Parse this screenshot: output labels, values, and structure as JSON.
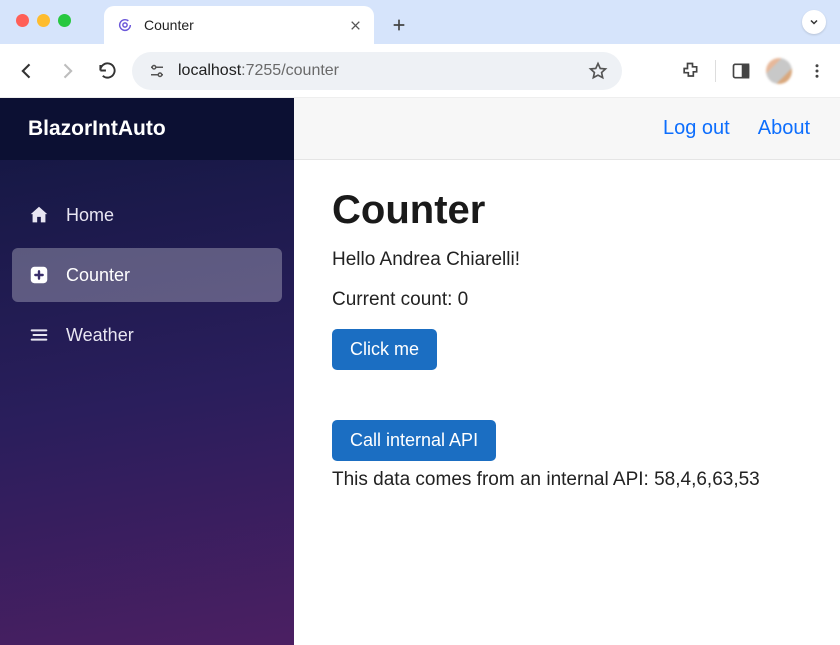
{
  "browser": {
    "tab_title": "Counter",
    "url_host": "localhost",
    "url_path": ":7255/counter"
  },
  "app": {
    "brand": "BlazorIntAuto",
    "nav": {
      "home": "Home",
      "counter": "Counter",
      "weather": "Weather"
    },
    "topbar": {
      "logout": "Log out",
      "about": "About"
    }
  },
  "page": {
    "title": "Counter",
    "greeting": "Hello Andrea Chiarelli!",
    "count_label": "Current count: 0",
    "click_button": "Click me",
    "api_button": "Call internal API",
    "api_result": "This data comes from an internal API: 58,4,6,63,53"
  }
}
